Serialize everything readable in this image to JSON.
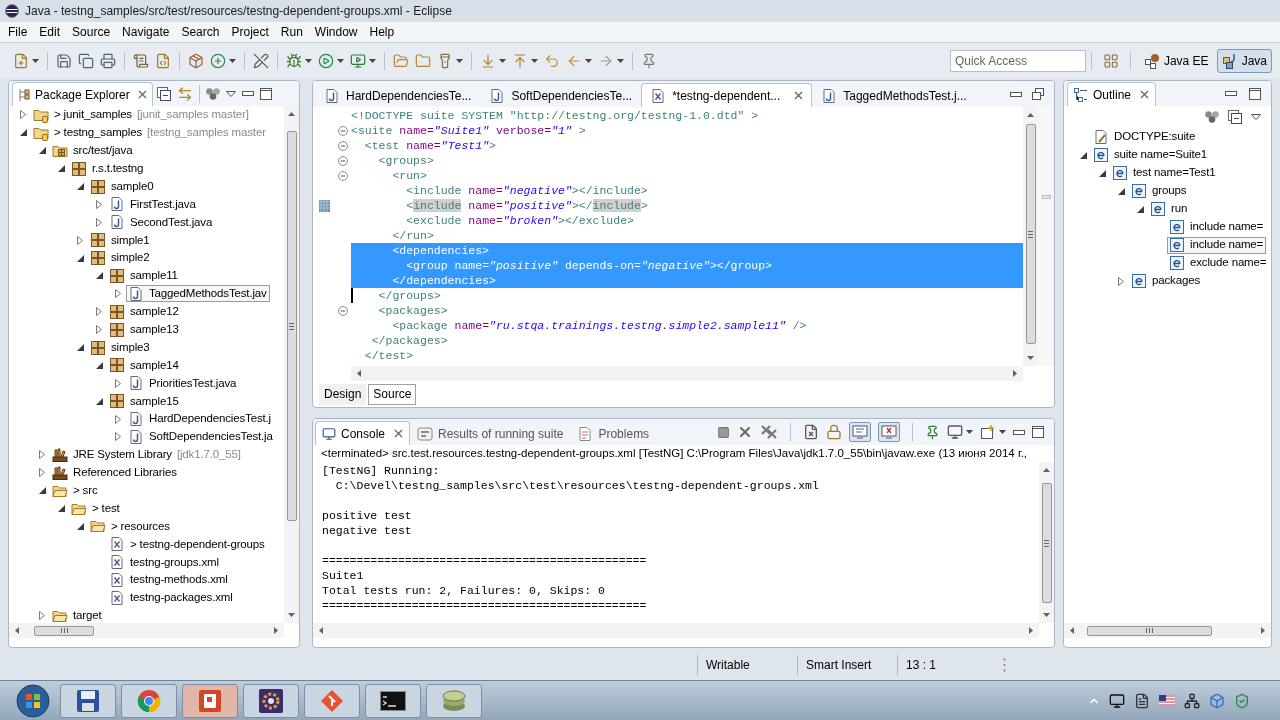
{
  "window": {
    "title": "Java - testng_samples/src/test/resources/testng-dependent-groups.xml - Eclipse"
  },
  "menu": [
    "File",
    "Edit",
    "Source",
    "Navigate",
    "Search",
    "Project",
    "Run",
    "Window",
    "Help"
  ],
  "toolbar": {
    "quick_access": {
      "placeholder": "Quick Access"
    },
    "perspectives": [
      {
        "kind": "javaee",
        "label": "Java EE",
        "selected": false
      },
      {
        "kind": "java",
        "label": "Java",
        "selected": true
      }
    ]
  },
  "package_explorer": {
    "title": "Package Explorer",
    "tree": [
      {
        "kind": "project",
        "label": "> junit_samples",
        "decoration": "[junit_samples master]",
        "expanded": false,
        "selected": false
      },
      {
        "kind": "project",
        "label": "> testng_samples",
        "decoration": "[testng_samples master",
        "expanded": true,
        "selected": false,
        "children": [
          {
            "kind": "source_folder",
            "label": "src/test/java",
            "expanded": true,
            "selected": false,
            "children": [
              {
                "kind": "package",
                "label": "r.s.t.testng",
                "expanded": true,
                "selected": false,
                "children": [
                  {
                    "kind": "package",
                    "label": "sample0",
                    "expanded": true,
                    "selected": false,
                    "children": [
                      {
                        "kind": "java",
                        "label": "FirstTest.java",
                        "expanded": false,
                        "selected": false
                      },
                      {
                        "kind": "java",
                        "label": "SecondTest.java",
                        "expanded": false,
                        "selected": false
                      }
                    ]
                  },
                  {
                    "kind": "package",
                    "label": "simple1",
                    "expanded": false,
                    "selected": false
                  },
                  {
                    "kind": "package",
                    "label": "simple2",
                    "expanded": true,
                    "selected": false,
                    "children": [
                      {
                        "kind": "package",
                        "label": "sample11",
                        "expanded": true,
                        "selected": false,
                        "children": [
                          {
                            "kind": "java",
                            "label": "TaggedMethodsTest.jav",
                            "expanded": false,
                            "selected": true
                          }
                        ]
                      },
                      {
                        "kind": "package",
                        "label": "sample12",
                        "expanded": false,
                        "selected": false
                      },
                      {
                        "kind": "package",
                        "label": "sample13",
                        "expanded": false,
                        "selected": false
                      }
                    ]
                  },
                  {
                    "kind": "package",
                    "label": "simple3",
                    "expanded": true,
                    "selected": false,
                    "children": [
                      {
                        "kind": "package",
                        "label": "sample14",
                        "expanded": true,
                        "selected": false,
                        "children": [
                          {
                            "kind": "java",
                            "label": "PrioritiesTest.java",
                            "expanded": false,
                            "selected": false
                          }
                        ]
                      },
                      {
                        "kind": "package",
                        "label": "sample15",
                        "expanded": true,
                        "selected": false,
                        "children": [
                          {
                            "kind": "java",
                            "label": "HardDependenciesTest.j",
                            "expanded": false,
                            "selected": false
                          },
                          {
                            "kind": "java",
                            "label": "SoftDependenciesTest.ja",
                            "expanded": false,
                            "selected": false
                          }
                        ]
                      }
                    ]
                  }
                ]
              }
            ]
          },
          {
            "kind": "library",
            "label": "JRE System Library",
            "decoration": "[jdk1.7.0_55]",
            "expanded": false,
            "selected": false
          },
          {
            "kind": "library",
            "label": "Referenced Libraries",
            "expanded": false,
            "selected": false
          },
          {
            "kind": "folder",
            "label": "> src",
            "expanded": true,
            "selected": false,
            "children": [
              {
                "kind": "folder",
                "label": "> test",
                "expanded": true,
                "selected": false,
                "children": [
                  {
                    "kind": "folder",
                    "label": "> resources",
                    "expanded": true,
                    "selected": false,
                    "children": [
                      {
                        "kind": "xml",
                        "label": "> testng-dependent-groups",
                        "selected": false
                      },
                      {
                        "kind": "xml",
                        "label": "testng-groups.xml",
                        "selected": false
                      },
                      {
                        "kind": "xml",
                        "label": "testng-methods.xml",
                        "selected": false
                      },
                      {
                        "kind": "xml",
                        "label": "testng-packages.xml",
                        "selected": false
                      }
                    ]
                  }
                ]
              }
            ]
          },
          {
            "kind": "folder",
            "label": "target",
            "expanded": false,
            "selected": false
          }
        ]
      }
    ]
  },
  "editor": {
    "tabs": [
      {
        "kind": "java",
        "label": "HardDependenciesTe...",
        "selected": false
      },
      {
        "kind": "java",
        "label": "SoftDependenciesTe...",
        "selected": false
      },
      {
        "kind": "xml",
        "label": "*testng-dependent...",
        "selected": true
      },
      {
        "kind": "java",
        "label": "TaggedMethodsTest.j...",
        "selected": false
      }
    ],
    "lines": [
      {
        "tokens": [
          {
            "kind": "doctype",
            "text": "<!DOCTYPE suite SYSTEM \"http://testng.org/testng-1.0.dtd\" >"
          }
        ],
        "foldable": false,
        "marked": false,
        "caret": false,
        "selected": false
      },
      {
        "tokens": [
          {
            "kind": "tag",
            "text": "<suite"
          },
          {
            "kind": "attr",
            "text": " name="
          },
          {
            "kind": "value",
            "text": "\"Suite1\""
          },
          {
            "kind": "attr",
            "text": " verbose="
          },
          {
            "kind": "value",
            "text": "\"1\""
          },
          {
            "kind": "tag",
            "text": " >"
          }
        ],
        "foldable": true,
        "marked": false,
        "caret": false,
        "selected": false
      },
      {
        "tokens": [
          {
            "kind": "tag",
            "text": "  <test"
          },
          {
            "kind": "attr",
            "text": " name="
          },
          {
            "kind": "value",
            "text": "\"Test1\""
          },
          {
            "kind": "tag",
            "text": ">"
          }
        ],
        "foldable": true,
        "marked": false,
        "caret": false,
        "selected": false
      },
      {
        "tokens": [
          {
            "kind": "tag",
            "text": "    <groups>"
          }
        ],
        "foldable": true,
        "marked": false,
        "caret": false,
        "selected": false
      },
      {
        "tokens": [
          {
            "kind": "tag",
            "text": "      <run>"
          }
        ],
        "foldable": true,
        "marked": false,
        "caret": false,
        "selected": false
      },
      {
        "tokens": [
          {
            "kind": "tag",
            "text": "        <include"
          },
          {
            "kind": "attr",
            "text": " name="
          },
          {
            "kind": "value",
            "text": "\"negative\""
          },
          {
            "kind": "tag",
            "text": "></include>"
          }
        ],
        "foldable": false,
        "marked": false,
        "caret": false,
        "selected": false
      },
      {
        "tokens": [
          {
            "kind": "tag",
            "text": "        <"
          },
          {
            "kind": "mark",
            "text": "include"
          },
          {
            "kind": "attr",
            "text": " name="
          },
          {
            "kind": "value",
            "text": "\"positive\""
          },
          {
            "kind": "tag",
            "text": "></"
          },
          {
            "kind": "mark",
            "text": "include"
          },
          {
            "kind": "tag",
            "text": ">"
          }
        ],
        "foldable": false,
        "marked": true,
        "caret": false,
        "selected": false
      },
      {
        "tokens": [
          {
            "kind": "tag",
            "text": "        <exclude"
          },
          {
            "kind": "attr",
            "text": " name="
          },
          {
            "kind": "value",
            "text": "\"broken\""
          },
          {
            "kind": "tag",
            "text": "></exclude>"
          }
        ],
        "foldable": false,
        "marked": false,
        "caret": false,
        "selected": false
      },
      {
        "tokens": [
          {
            "kind": "tag",
            "text": "      </run>"
          }
        ],
        "foldable": false,
        "marked": false,
        "caret": false,
        "selected": false
      },
      {
        "tokens": [
          {
            "kind": "tag",
            "text": "      <dependencies>"
          }
        ],
        "foldable": false,
        "marked": false,
        "caret": false,
        "selected": true
      },
      {
        "tokens": [
          {
            "kind": "tag",
            "text": "        <group"
          },
          {
            "kind": "attr",
            "text": " name="
          },
          {
            "kind": "value",
            "text": "\"positive\""
          },
          {
            "kind": "attr",
            "text": " depends-on="
          },
          {
            "kind": "value",
            "text": "\"negative\""
          },
          {
            "kind": "tag",
            "text": "></group>"
          }
        ],
        "foldable": false,
        "marked": false,
        "caret": false,
        "selected": true
      },
      {
        "tokens": [
          {
            "kind": "tag",
            "text": "      </dependencies>"
          }
        ],
        "foldable": false,
        "marked": false,
        "caret": false,
        "selected": true
      },
      {
        "tokens": [
          {
            "kind": "tag",
            "text": "    </groups>"
          }
        ],
        "foldable": false,
        "marked": false,
        "caret": true,
        "selected": false
      },
      {
        "tokens": [
          {
            "kind": "tag",
            "text": "    <packages>"
          }
        ],
        "foldable": true,
        "marked": false,
        "caret": false,
        "selected": false
      },
      {
        "tokens": [
          {
            "kind": "tag",
            "text": "      <package"
          },
          {
            "kind": "attr",
            "text": " name="
          },
          {
            "kind": "value",
            "text": "\"ru.stqa.trainings.testng.simple2.sample11\""
          },
          {
            "kind": "tag",
            "text": " />"
          }
        ],
        "foldable": false,
        "marked": false,
        "caret": false,
        "selected": false
      },
      {
        "tokens": [
          {
            "kind": "tag",
            "text": "   </packages>"
          }
        ],
        "foldable": false,
        "marked": false,
        "caret": false,
        "selected": false
      },
      {
        "tokens": [
          {
            "kind": "tag",
            "text": "  </test>"
          }
        ],
        "foldable": false,
        "marked": false,
        "caret": false,
        "selected": false
      }
    ],
    "bottom_tabs": [
      {
        "label": "Design",
        "selected": false
      },
      {
        "label": "Source",
        "selected": true
      }
    ]
  },
  "console": {
    "tabs": [
      {
        "kind": "console",
        "label": "Console",
        "selected": true
      },
      {
        "kind": "results",
        "label": "Results of running suite",
        "selected": false
      },
      {
        "kind": "problems",
        "label": "Problems",
        "selected": false
      }
    ],
    "toggles": [
      {
        "kind": "stdout",
        "on": true
      },
      {
        "kind": "stderr",
        "on": true
      }
    ],
    "header": "<terminated> src.test.resources.testng-dependent-groups.xml [TestNG] C:\\Program Files\\Java\\jdk1.7.0_55\\bin\\javaw.exe (13 июня 2014 г.,",
    "output": [
      [
        "[TestNG] Running:",
        "  C:\\Devel\\testng_samples\\src\\test\\resources\\testng-dependent-groups.xml"
      ],
      [
        "positive test",
        "negative test"
      ],
      [
        "===============================================",
        "Suite1",
        "Total tests run: 2, Failures: 0, Skips: 0",
        "==============================================="
      ]
    ]
  },
  "outline": {
    "title": "Outline",
    "tree": [
      {
        "kind": "doctype",
        "label": "DOCTYPE:suite",
        "selected": false
      },
      {
        "kind": "element",
        "label": "suite name=Suite1",
        "expanded": true,
        "selected": false,
        "children": [
          {
            "kind": "element",
            "label": "test name=Test1",
            "expanded": true,
            "selected": false,
            "children": [
              {
                "kind": "element",
                "label": "groups",
                "expanded": true,
                "selected": false,
                "children": [
                  {
                    "kind": "element",
                    "label": "run",
                    "expanded": true,
                    "selected": false,
                    "children": [
                      {
                        "kind": "element",
                        "label": "include name=",
                        "selected": false
                      },
                      {
                        "kind": "element",
                        "label": "include name=",
                        "selected": true
                      },
                      {
                        "kind": "element",
                        "label": "exclude name=",
                        "selected": false
                      }
                    ]
                  }
                ]
              },
              {
                "kind": "element",
                "label": "packages",
                "expanded": false,
                "selected": false
              }
            ]
          }
        ]
      }
    ]
  },
  "status_bar": [
    "Writable",
    "Smart Insert",
    "13 : 1"
  ]
}
